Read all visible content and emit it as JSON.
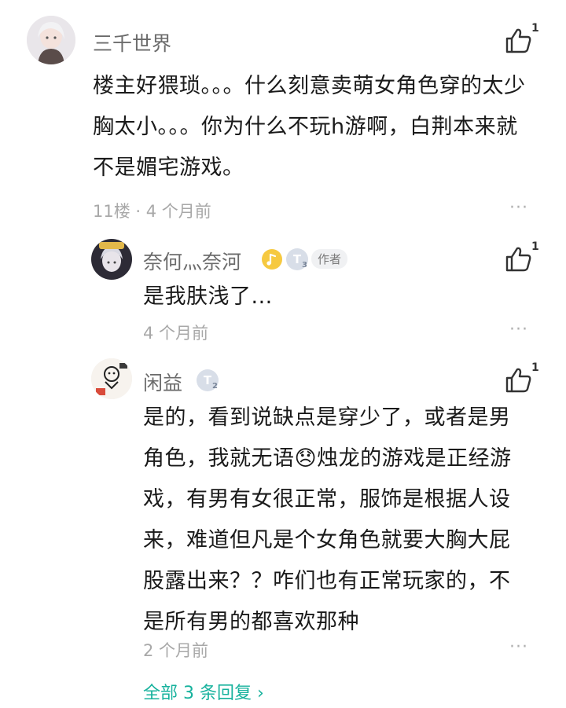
{
  "main_comment": {
    "username": "三千世界",
    "text": "楼主好猥琐。。。什么刻意卖萌女角色穿的太少胸太小。。。你为什么不玩h游啊，白荆本来就不是媚宅游戏。",
    "meta": "11楼 · 4 个月前",
    "likes": "1"
  },
  "replies": [
    {
      "username": "奈何灬奈河",
      "level_badge": "T",
      "level_num": "3",
      "author_tag": "作者",
      "text": "是我肤浅了...",
      "meta": "4 个月前",
      "likes": "1"
    },
    {
      "username": "闲益",
      "level_badge": "T",
      "level_num": "2",
      "text_before_emoji": "是的，看到说缺点是穿少了，或者是男角色，我就无语",
      "emoji": "😞",
      "text_after_emoji": "烛龙的游戏是正经游戏，有男有女很正常，服饰是根据人设来，难道但凡是个女角色就要大胸大屁股露出来？？咋们也有正常玩家的，不是所有男的都喜欢那种",
      "meta": "2 个月前",
      "likes": "1"
    }
  ],
  "view_all_replies": "全部 3 条回复 ›",
  "more_symbol": "···",
  "colors": {
    "accent": "#17b29d",
    "meta_gray": "#a8a8a8",
    "name_gray": "#6b6b6b"
  }
}
